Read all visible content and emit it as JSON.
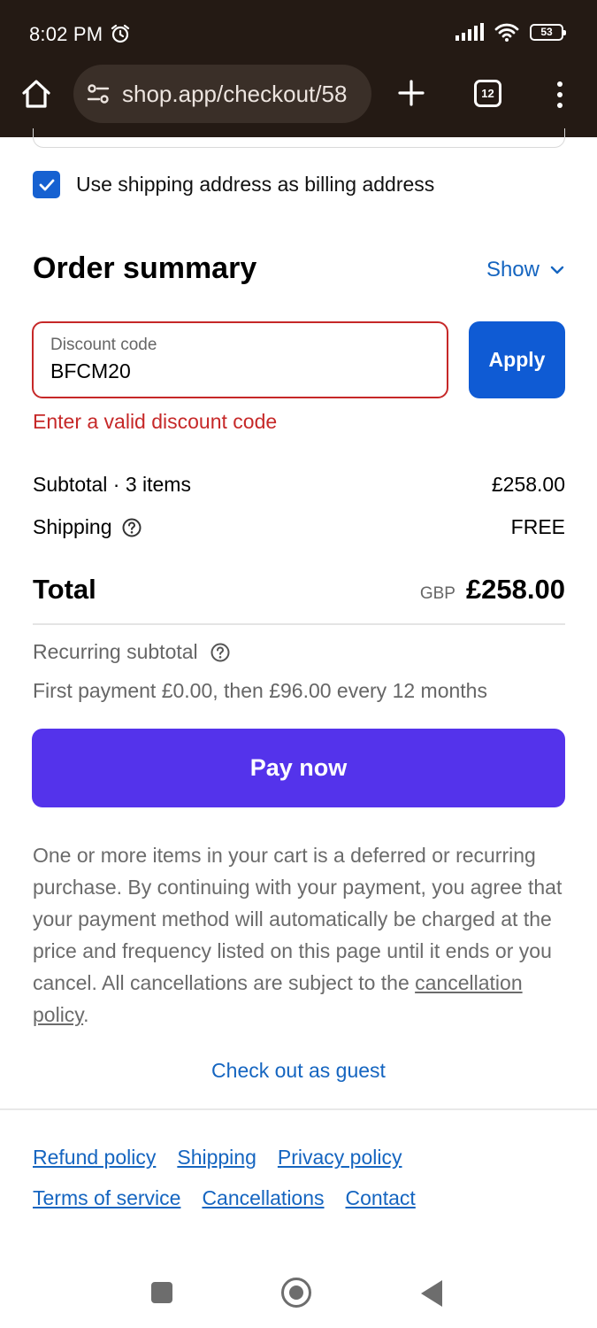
{
  "status_bar": {
    "time": "8:02 PM",
    "battery": "53"
  },
  "browser": {
    "url": "shop.app/checkout/58",
    "tab_count": "12"
  },
  "billing": {
    "checkbox_label": "Use shipping address as billing address",
    "checked": true
  },
  "order_summary": {
    "title": "Order summary",
    "toggle_label": "Show"
  },
  "discount": {
    "label": "Discount code",
    "value": "BFCM20",
    "apply_label": "Apply",
    "error": "Enter a valid discount code"
  },
  "totals": {
    "subtotal_label": "Subtotal · 3 items",
    "subtotal_value": "£258.00",
    "shipping_label": "Shipping",
    "shipping_value": "FREE",
    "total_label": "Total",
    "currency": "GBP",
    "total_value": "£258.00"
  },
  "recurring": {
    "label": "Recurring subtotal",
    "detail": "First payment £0.00, then £96.00 every 12 months"
  },
  "pay_button": "Pay now",
  "disclaimer": {
    "text": "One or more items in your cart is a deferred or recurring purchase. By continuing with your payment, you agree that your payment method will automatically be charged at the price and frequency listed on this page until it ends or you cancel. All cancellations are subject to the ",
    "link": "cancellation policy",
    "end": "."
  },
  "guest_link": "Check out as guest",
  "footer_links": [
    "Refund policy",
    "Shipping",
    "Privacy policy",
    "Terms of service",
    "Cancellations",
    "Contact"
  ],
  "colors": {
    "chrome_bg": "#241a14",
    "accent_blue": "#0f5bd4",
    "link_blue": "#1565c0",
    "error_red": "#c62828",
    "pay_purple": "#5433eb"
  }
}
